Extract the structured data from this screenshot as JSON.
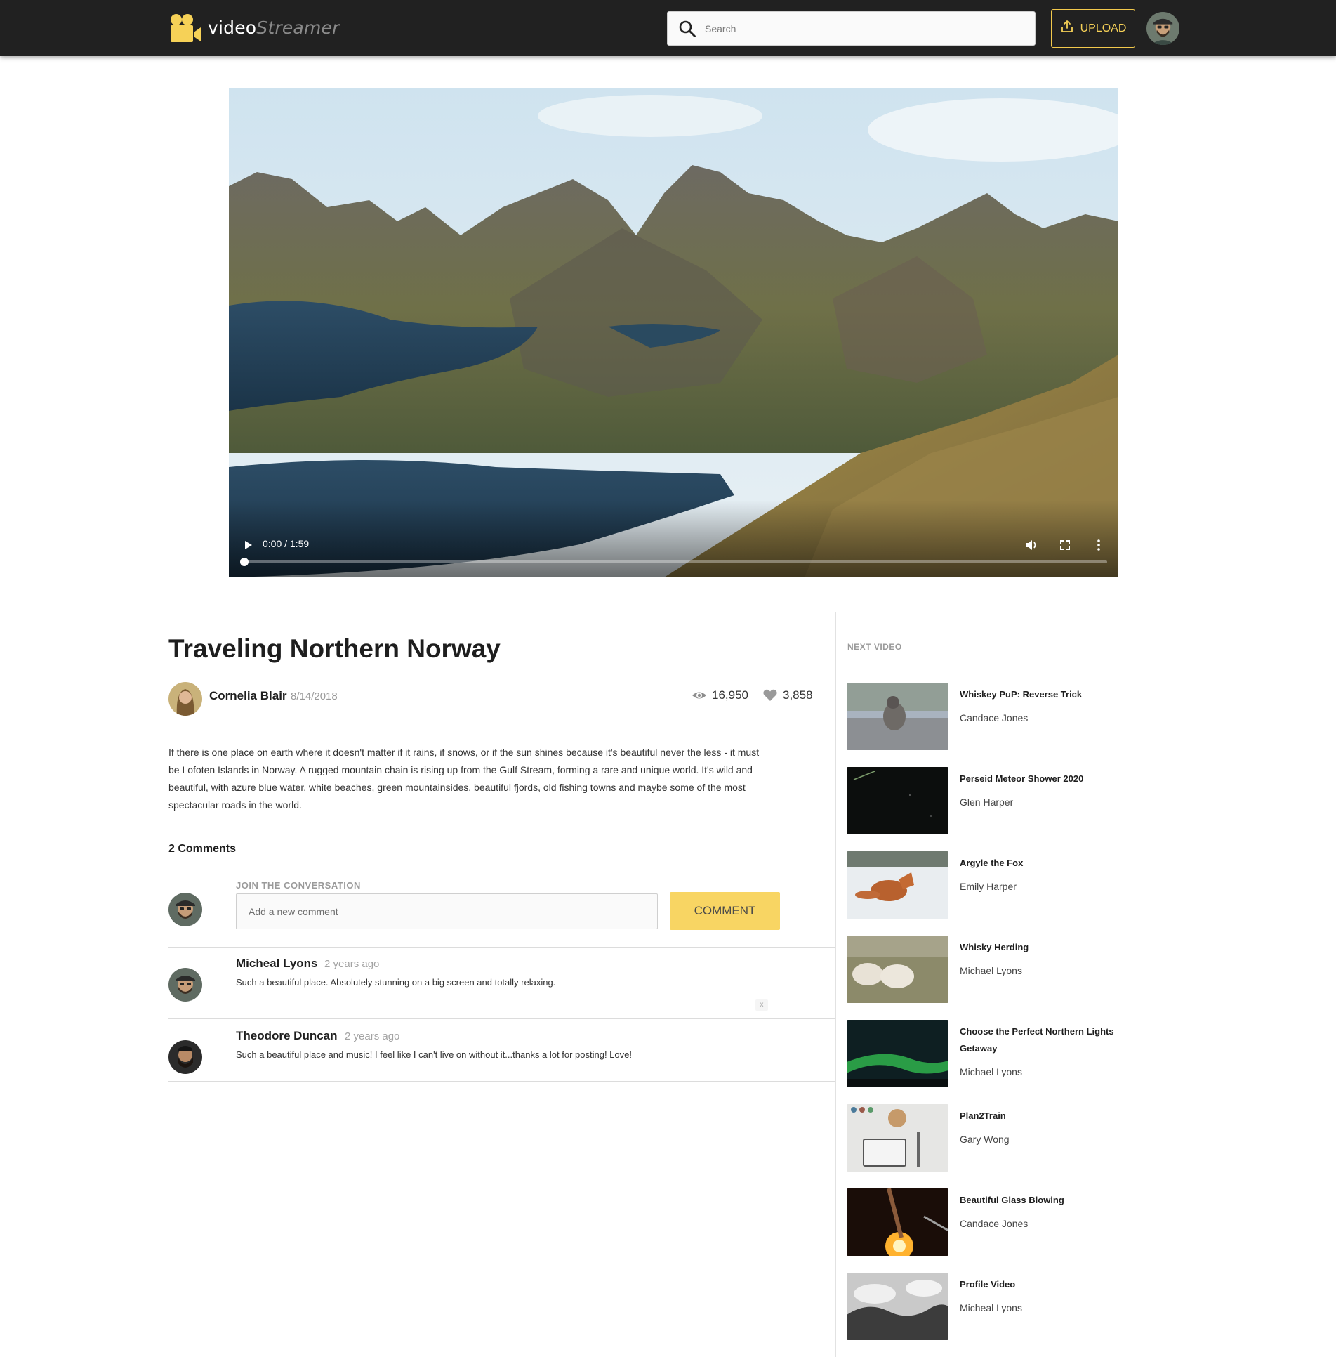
{
  "header": {
    "logo_word1": "video",
    "logo_word2": "Streamer",
    "search_placeholder": "Search",
    "upload_label": "UPLOAD",
    "accent_color": "#f6d157",
    "background_color": "#212121"
  },
  "video": {
    "time_current": "0:00",
    "time_total": "1:59",
    "time_display": "0:00 / 1:59",
    "progress_fraction": 0.0
  },
  "main": {
    "title": "Traveling Northern Norway",
    "author": "Cornelia Blair",
    "date": "8/14/2018",
    "views": "16,950",
    "likes": "3,858",
    "description": "If there is one place on earth where it doesn't matter if it rains, if snows, or if the sun shines because it's beautiful never the less - it must be Lofoten Islands in Norway. A rugged mountain chain is rising up from the Gulf Stream, forming a rare and unique world. It's wild and beautiful, with azure blue water, white beaches, green mountainsides, beautiful fjords, old fishing towns and maybe some of the most spectacular roads in the world."
  },
  "comments": {
    "count_label": "2 Comments",
    "join_label": "JOIN THE CONVERSATION",
    "input_placeholder": "Add a new comment",
    "button_label": "COMMENT",
    "button_color": "#f8d563",
    "delete_label": "x",
    "items": [
      {
        "name": "Micheal Lyons",
        "time": "2 years ago",
        "text": "Such a beautiful place. Absolutely stunning on a big screen and totally relaxing."
      },
      {
        "name": "Theodore Duncan",
        "time": "2 years ago",
        "text": "Such a beautiful place and music! I feel like I can't live on without it...thanks a lot for posting! Love!"
      }
    ]
  },
  "sidebar": {
    "heading": "NEXT VIDEO",
    "items": [
      {
        "title": "Whiskey PuP: Reverse Trick",
        "author": "Candace Jones"
      },
      {
        "title": "Perseid Meteor Shower 2020",
        "author": "Glen Harper"
      },
      {
        "title": "Argyle the Fox",
        "author": "Emily Harper"
      },
      {
        "title": "Whisky Herding",
        "author": "Michael Lyons"
      },
      {
        "title": "Choose the Perfect Northern Lights Getaway",
        "author": "Michael Lyons"
      },
      {
        "title": "Plan2Train",
        "author": "Gary Wong"
      },
      {
        "title": "Beautiful Glass Blowing",
        "author": "Candace Jones"
      },
      {
        "title": "Profile Video",
        "author": "Micheal Lyons"
      }
    ]
  }
}
